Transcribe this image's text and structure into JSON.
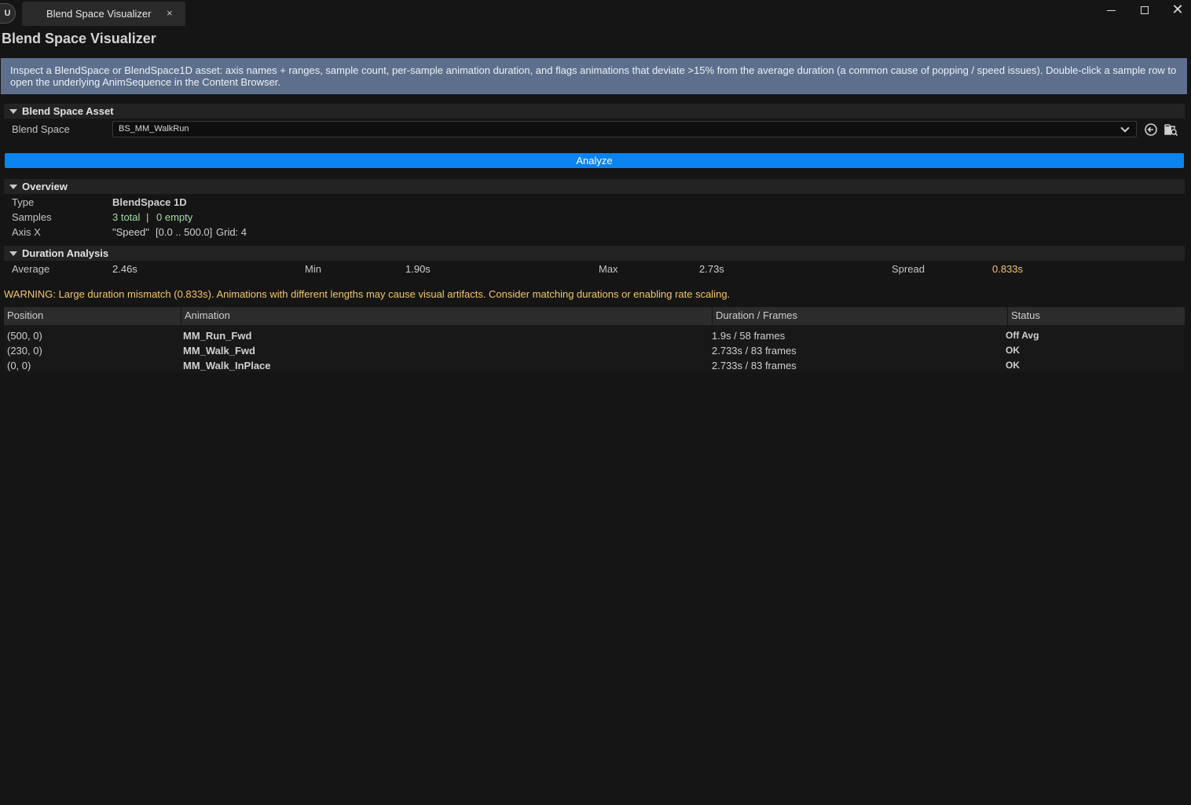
{
  "window": {
    "tab_title": "Blend Space Visualizer",
    "tab_close": "×",
    "close_glyph": "✕",
    "logo": "U"
  },
  "page": {
    "title": "Blend Space Visualizer",
    "info": "Inspect a BlendSpace or BlendSpace1D asset: axis names + ranges, sample count, per-sample animation duration, and flags animations that deviate >15% from the average duration (a common cause of popping / speed issues). Double-click a sample row to open the underlying AnimSequence in the Content Browser."
  },
  "asset_section": {
    "header": "Blend Space Asset",
    "blend_space_label": "Blend Space",
    "blend_space_value": "BS_MM_WalkRun",
    "analyze_label": "Analyze"
  },
  "overview": {
    "header": "Overview",
    "type_label": "Type",
    "type_value": "BlendSpace 1D",
    "samples_label": "Samples",
    "samples_total": "3 total",
    "samples_sep": "|",
    "samples_empty": "0 empty",
    "axis_label": "Axis X",
    "axis_name": "\"Speed\"",
    "axis_range": "[0.0 .. 500.0]",
    "axis_grid": "Grid: 4"
  },
  "duration": {
    "header": "Duration Analysis",
    "average_label": "Average",
    "average_value": "2.46s",
    "min_label": "Min",
    "min_value": "1.90s",
    "max_label": "Max",
    "max_value": "2.73s",
    "spread_label": "Spread",
    "spread_value": "0.833s",
    "warning": "WARNING: Large duration mismatch (0.833s). Animations with different lengths may cause visual artifacts. Consider matching durations or enabling rate scaling."
  },
  "table": {
    "headers": [
      "Position",
      "Animation",
      "Duration / Frames",
      "Status"
    ],
    "rows": [
      {
        "position": "(500, 0)",
        "animation": "MM_Run_Fwd",
        "duration": "1.9s / 58 frames",
        "status": "Off Avg",
        "color": "#f2c66c"
      },
      {
        "position": "(230, 0)",
        "animation": "MM_Walk_Fwd",
        "duration": "2.733s / 83 frames",
        "status": "OK",
        "color": "#a3dda6"
      },
      {
        "position": "(0, 0)",
        "animation": "MM_Walk_InPlace",
        "duration": "2.733s / 83 frames",
        "status": "OK",
        "color": "#a3dda6"
      }
    ]
  },
  "colors": {
    "accent": "#0a84f0",
    "banner": "#5d6f8d",
    "warning": "#f2c66c",
    "ok": "#a3dda6"
  }
}
